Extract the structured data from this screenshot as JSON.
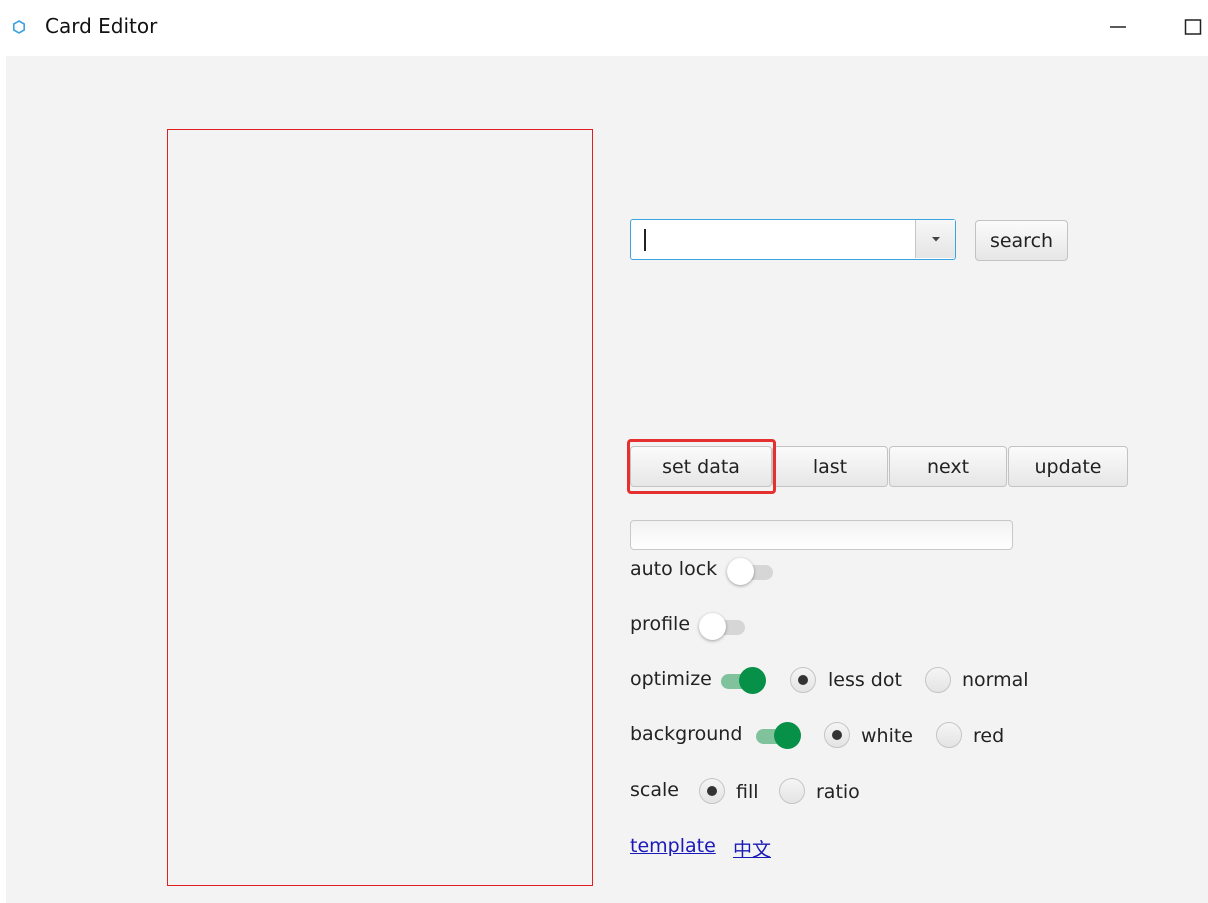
{
  "window": {
    "title": "Card Editor",
    "minimize_glyph": "—",
    "maximize_glyph": "☐"
  },
  "search": {
    "input_value": "",
    "search_label": "search"
  },
  "actions": {
    "set_data": "set data",
    "last": "last",
    "next": "next",
    "update": "update"
  },
  "highlight_color": "#e53030",
  "options": {
    "auto_lock": {
      "label": "auto lock",
      "on": false
    },
    "profile": {
      "label": "profile",
      "on": false
    },
    "optimize": {
      "label": "optimize",
      "on": true,
      "choices": [
        "less dot",
        "normal"
      ],
      "selected": "less dot"
    },
    "background": {
      "label": "background",
      "on": true,
      "choices": [
        "white",
        "red"
      ],
      "selected": "white"
    },
    "scale": {
      "label": "scale",
      "choices": [
        "fill",
        "ratio"
      ],
      "selected": "fill"
    }
  },
  "links": {
    "template": "template",
    "chinese": "中文"
  },
  "colors": {
    "accent_green": "#079048",
    "focus_blue": "#39a4dd",
    "preview_border": "#e02020",
    "link_blue": "#1a1ab8"
  }
}
